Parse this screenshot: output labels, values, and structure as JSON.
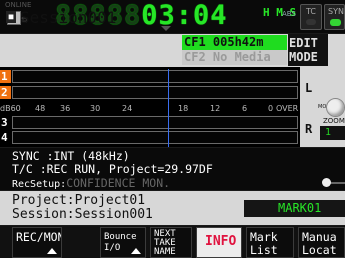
{
  "top": {
    "online_label": "ONLINE",
    "counter_digits": "88888",
    "counter_active": "03:04",
    "unit_hms": "H M S",
    "abs_label": "ABS",
    "tc_label": "TC",
    "sync_label": "SYN"
  },
  "session": {
    "name": "Session001",
    "cf1": "CF1 005h42m",
    "cf2": "CF2 No Media",
    "edit_label_1": "EDIT",
    "edit_label_2": "MODE"
  },
  "meters": {
    "tracks": [
      "1",
      "2",
      "3",
      "4"
    ],
    "scale": [
      "dB60",
      "48",
      "36",
      "30",
      "24",
      "18",
      "12",
      "6",
      "0",
      "OVER"
    ],
    "left_label": "L",
    "right_label": "R",
    "mon_label": "MON",
    "zoom_label": "ZOOM",
    "zoom_value": "1"
  },
  "info": {
    "sync_line": "SYNC     :INT (48kHz)",
    "tc_line": "T/C      :REC RUN, Project=29.97DF",
    "recsetup_label": "RecSetup:",
    "recsetup_value": "CONFIDENCE MON."
  },
  "project": {
    "project_line": "Project:Project01",
    "session_line": "Session:Session001",
    "mark": "MARK01"
  },
  "fkeys": {
    "rec_mon": "REC/MON",
    "bounce_1": "Bounce",
    "bounce_2": "I/O",
    "next_1": "NEXT",
    "next_2": "TAKE",
    "next_3": "NAME",
    "info": "INFO",
    "mark_1": "Mark",
    "mark_2": "List",
    "manual_1": "Manua",
    "manual_2": "Locat"
  },
  "colors": {
    "counter_green": "#27e627",
    "cf1_green": "#1fdc1f",
    "armed_orange": "#f07010",
    "info_red": "#e0133f",
    "cursor_blue": "#3a6ef0"
  }
}
